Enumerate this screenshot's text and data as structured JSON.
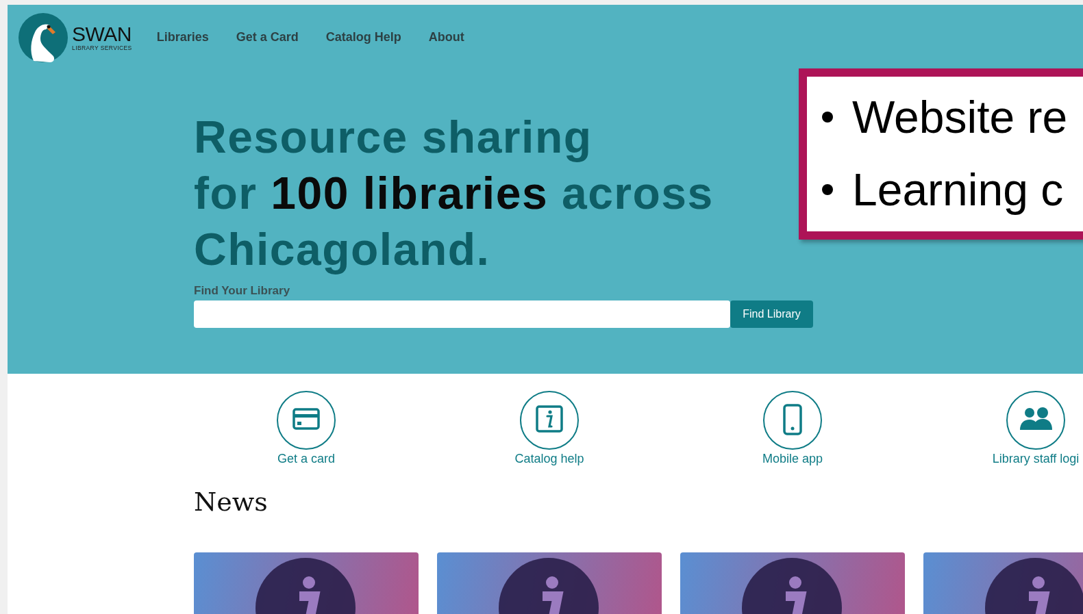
{
  "header": {
    "logo": {
      "name": "SWAN",
      "tagline": "LIBRARY SERVICES"
    },
    "nav": [
      "Libraries",
      "Get a Card",
      "Catalog Help",
      "About"
    ]
  },
  "hero": {
    "headline": [
      "Resource sharing",
      "for **100 libraries** across",
      "Chicagoland."
    ],
    "search": {
      "label": "Find Your Library",
      "button": "Find Library"
    }
  },
  "callout": {
    "bullets": [
      "Website re",
      "Learning c"
    ]
  },
  "quick_links": [
    {
      "kind": "card",
      "label": "Get a card"
    },
    {
      "kind": "info",
      "label": "Catalog help"
    },
    {
      "kind": "phone",
      "label": "Mobile app"
    },
    {
      "kind": "people",
      "label": "Library staff logi"
    }
  ],
  "news": {
    "heading": "News",
    "cards": [
      {
        "kind": "info"
      },
      {
        "kind": "info"
      },
      {
        "kind": "info"
      },
      {
        "kind": "info"
      }
    ]
  }
}
